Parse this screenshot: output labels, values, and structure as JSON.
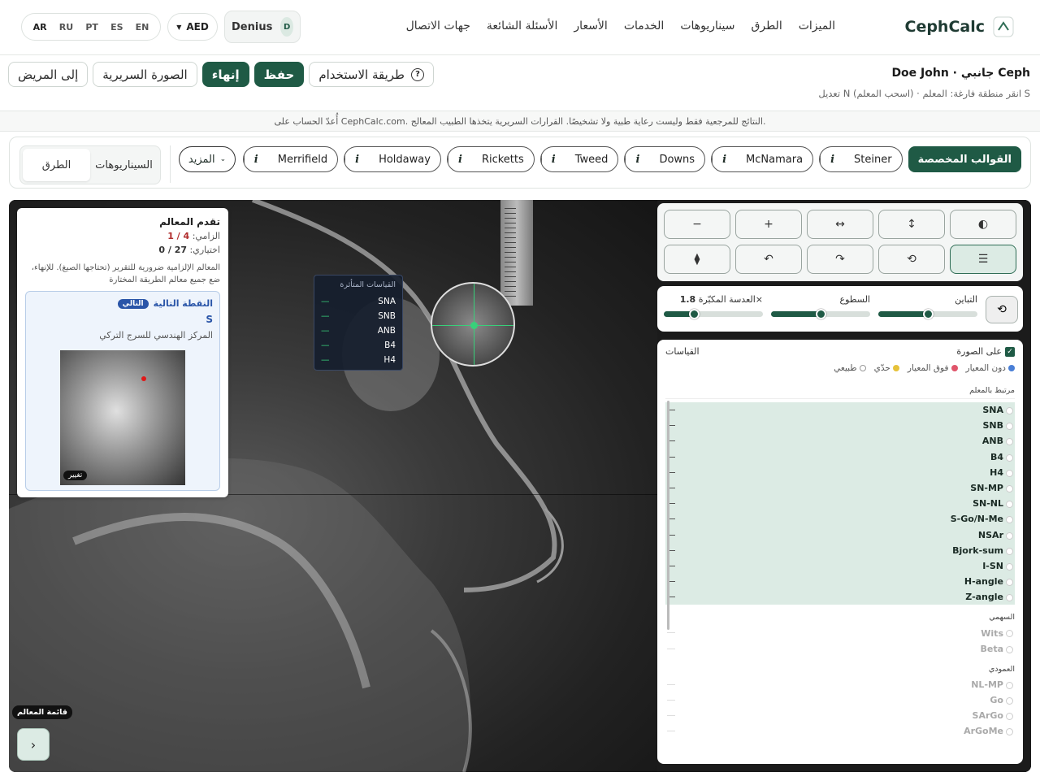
{
  "nav": {
    "brand": "CephCalc",
    "links": [
      "الميزات",
      "الطرق",
      "سيناريوهات",
      "الخدمات",
      "الأسعار",
      "الأسئلة الشائعة",
      "جهات الاتصال"
    ],
    "user": "Denius",
    "user_initial": "D",
    "currency": "AED",
    "languages": [
      "AR",
      "RU",
      "PT",
      "ES",
      "EN"
    ]
  },
  "patient": {
    "title": "Doe John · جانبي Ceph",
    "hint": "تعديل N (اسحب المعلم) · انقر منطقة فارغة: المعلم S"
  },
  "actions": {
    "how_to": "طريقة الاستخدام",
    "how_to_icon": "?",
    "save": "حفظ",
    "finish": "إنهاء",
    "clinical": "الصورة السريرية",
    "to_patient": "إلى المريض"
  },
  "disclaimer": "أُعدّ الحساب على CephCalc.com. النتائج للمرجعية فقط وليست رعاية طبية ولا تشخيصًا. القرارات السريرية يتخذها الطبيب المعالج.",
  "methods": {
    "segment": [
      "السيناريوهات",
      "الطرق"
    ],
    "more": "المزيد",
    "custom": "القوالب المخصصة",
    "info_glyph": "i",
    "list": [
      "Steiner",
      "McNamara",
      "Downs",
      "Tweed",
      "Ricketts",
      "Holdaway",
      "Merrifield"
    ]
  },
  "progress": {
    "title": "تقدم المعالم",
    "req_label": "الزامي:",
    "req_value": "4 / 1",
    "opt_label": "اختياري:",
    "opt_value": "27 / 0",
    "note": "المعالم الإلزامية ضرورية للتقرير (تحتاجها الصيغ). للإنهاء، ضع جميع معالم الطريقة المختارة",
    "next_label": "النقطة التالية",
    "next_pill": "التالي",
    "next_code": "S",
    "next_desc": "المركز الهندسي للسرج التركي",
    "change": "تغيير"
  },
  "floating": {
    "title": "القياسات المتأثرة",
    "items": [
      "SNA",
      "SNB",
      "ANB",
      "B4",
      "H4"
    ],
    "dash": "—"
  },
  "landmark_list": "قائمة المعالم",
  "tools": [
    "◐",
    "↕",
    "↔",
    "+",
    "−",
    "☰",
    "⟲",
    "↷",
    "↶",
    "⧫"
  ],
  "sliders": {
    "contrast": "التباين",
    "brightness": "السطوع",
    "zoom_lens": "×العدسة المكبّرة",
    "zoom_value": "1.8",
    "contrast_level": 0.5,
    "brightness_level": 0.5,
    "zoom_level": 0.3
  },
  "measurements": {
    "title": "القياسات",
    "on_image": "على الصورة",
    "legend": [
      "دون المعيار",
      "فوق المعيار",
      "حدّي",
      "طبيعي"
    ],
    "legend_colors": [
      "#4a7fd6",
      "#e0556b",
      "#e6c23a",
      "#ffffff"
    ],
    "section_landmark": "مرتبط بالمعلم",
    "landmark_items": [
      "SNA",
      "SNB",
      "ANB",
      "B4",
      "H4",
      "SN-MP",
      "SN-NL",
      "S-Go/N-Me",
      "NSAr",
      "Bjork-sum",
      "I-SN",
      "H-angle",
      "Z-angle"
    ],
    "section_sagittal": "السهمي",
    "sagittal_items": [
      "Wits",
      "Beta"
    ],
    "section_vertical": "العمودي",
    "vertical_items": [
      "NL-MP",
      "Go",
      "SArGo",
      "ArGoMe"
    ]
  }
}
